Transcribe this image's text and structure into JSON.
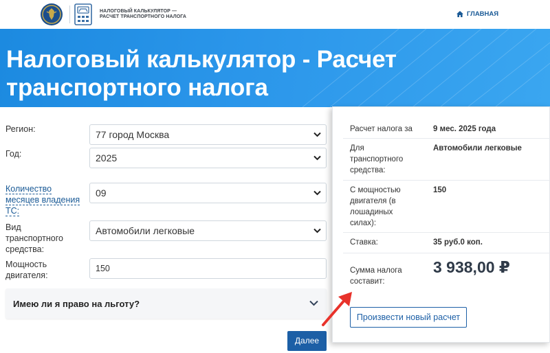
{
  "header": {
    "brand_line1": "НАЛОГОВЫЙ КАЛЬКУЛЯТОР —",
    "brand_line2": "РАСЧЕТ ТРАНСПОРТНОГО НАЛОГА",
    "home_label": "ГЛАВНАЯ",
    "icons": [
      "emblem-icon",
      "calculator-car-icon",
      "home-icon"
    ]
  },
  "hero": {
    "title": "Налоговый калькулятор - Расчет транспортного налога"
  },
  "form": {
    "region_label": "Регион:",
    "region_value": "77 город Москва",
    "year_label": "Год:",
    "year_value": "2025",
    "months_label": "Количество месяцев владения ТС:",
    "months_value": "09",
    "vehicle_type_label": "Вид транспортного средства:",
    "vehicle_type_value": "Автомобили легковые",
    "power_label": "Мощность двигателя:",
    "power_value": "150",
    "benefit_label": "Имею ли я право на льготу?",
    "next_label": "Далее"
  },
  "result": {
    "period_key": "Расчет налога за",
    "period_value": "9 мес. 2025 года",
    "vehicle_key": "Для транспортного средства:",
    "vehicle_value": "Автомобили легковые",
    "power_key": "С мощностью двигателя (в лошадиных силах):",
    "power_value": "150",
    "rate_key": "Ставка:",
    "rate_value": "35 руб.0 коп.",
    "sum_key": "Сумма налога составит:",
    "sum_value": "3 938,00 ₽",
    "new_calc_label": "Произвести новый расчет"
  },
  "colors": {
    "hero_blue": "#2b96ea",
    "primary_button": "#1c5fa6",
    "link": "#1a5a96",
    "annotation_arrow": "#e8322b"
  }
}
